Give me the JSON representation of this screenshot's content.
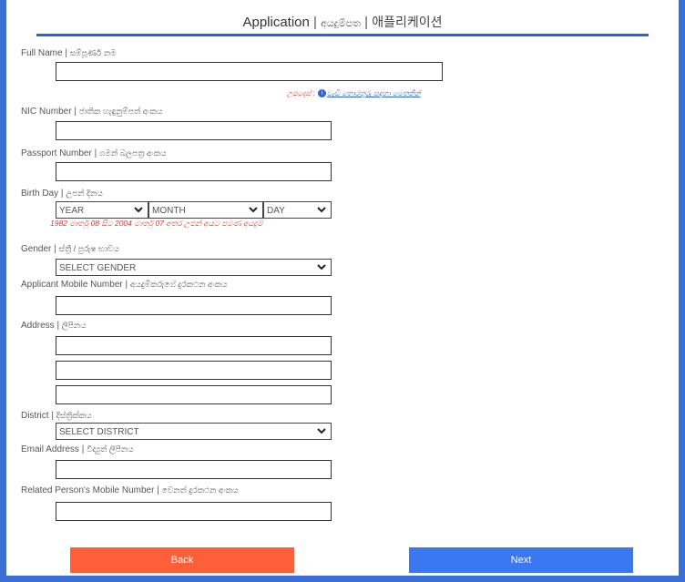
{
  "header": {
    "title": "Application",
    "sep": "|",
    "title_si": "අයදුම්පත",
    "title_ko": "애플리케이션"
  },
  "fields": {
    "full_name": {
      "label": "Full Name",
      "label_si": "සම්පූර්ණ නම",
      "value": ""
    },
    "full_name_hint": {
      "prefix": "උපදෙස් :",
      "info": "i",
      "link": "වැඩි තොරතුරු සඳහා මෙතනින්"
    },
    "nic": {
      "label": "NIC Number",
      "label_si": "ජාතික හැඳුනුම්පත් අංකය",
      "value": ""
    },
    "passport": {
      "label": "Passport Number",
      "label_si": "ගමන් බලපත්‍ර අංකය",
      "value": ""
    },
    "birthday": {
      "label": "Birth Day",
      "label_si": "උපන් දිනය",
      "year": "YEAR",
      "month": "MONTH",
      "day": "DAY",
      "note": "1982 මාර්තු 08 සිට 2004 මාර්තු 07 අතර උපන් අයට පමණ අයදුම්",
      "note_display": "1982 මාර්තු 08 සිට 2004 මාර්තු 07 අතර උපන් අයට පමණ අයදුම්"
    },
    "gender": {
      "label": "Gender",
      "label_si": "ස්ත්‍රී / පුරුෂ භාවය",
      "selected": "SELECT GENDER"
    },
    "mobile": {
      "label": "Applicant Mobile Number",
      "label_si": "අයදුම්කරුගේ දුරකථන අංකය",
      "value": ""
    },
    "address": {
      "label": "Address",
      "label_si": "ලිපිනය",
      "line1": "",
      "line2": "",
      "line3": ""
    },
    "district": {
      "label": "District",
      "label_si": "දිස්ත්‍රික්කය",
      "selected": "SELECT DISTRICT"
    },
    "email": {
      "label": "Email Address",
      "label_si": "විද්‍යුත් ලිපිනය",
      "value": ""
    },
    "related_mobile": {
      "label": "Related Person's Mobile Number",
      "label_si": "වෙනත් දුරකථන අංකය",
      "value": ""
    }
  },
  "buttons": {
    "back": "Back",
    "next": "Next"
  },
  "colors": {
    "accent": "#2e64d2",
    "back": "#ff5f38",
    "next": "#3b78ef",
    "error": "#dd3333"
  },
  "icons": {
    "chevron": "chevron-down-icon",
    "info": "info-icon"
  }
}
